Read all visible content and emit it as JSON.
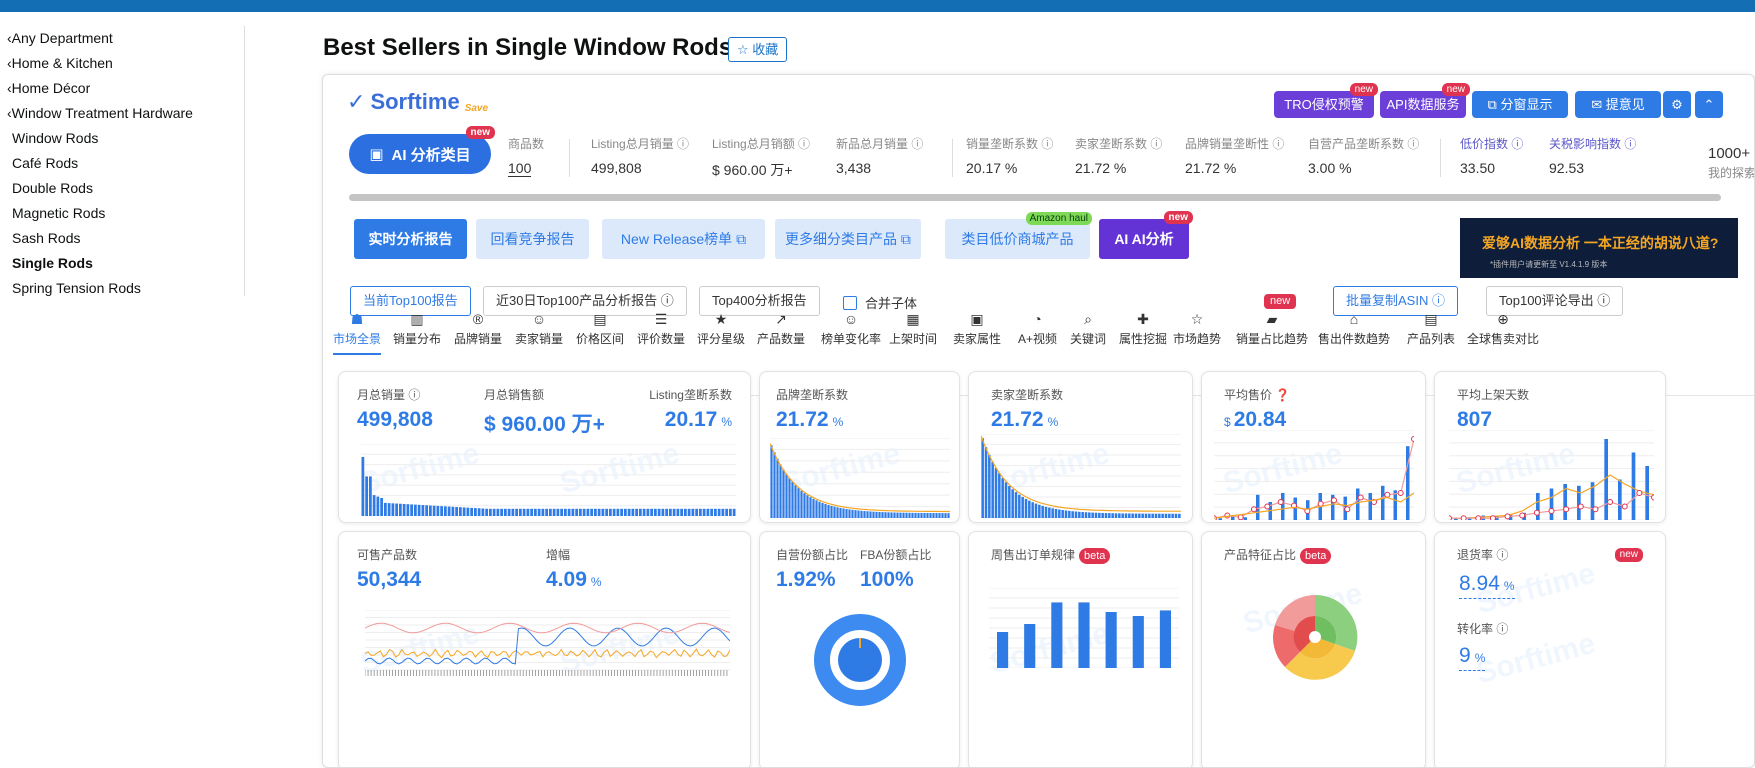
{
  "sidebar": {
    "items": [
      {
        "label": "‹Any Department",
        "sub": false,
        "selected": false
      },
      {
        "label": "‹Home & Kitchen",
        "sub": false,
        "selected": false
      },
      {
        "label": "‹Home Décor",
        "sub": false,
        "selected": false
      },
      {
        "label": "‹Window Treatment Hardware",
        "sub": false,
        "selected": false
      },
      {
        "label": "Window Rods",
        "sub": true,
        "selected": false
      },
      {
        "label": "Café Rods",
        "sub": true,
        "selected": false
      },
      {
        "label": "Double Rods",
        "sub": true,
        "selected": false
      },
      {
        "label": "Magnetic Rods",
        "sub": true,
        "selected": false
      },
      {
        "label": "Sash Rods",
        "sub": true,
        "selected": false
      },
      {
        "label": "Single Rods",
        "sub": true,
        "selected": true
      },
      {
        "label": "Spring Tension Rods",
        "sub": true,
        "selected": false
      }
    ]
  },
  "page": {
    "title": "Best Sellers in Single Window Rods",
    "fav_label": "☆ 收藏"
  },
  "plugin": {
    "logo_text": "Sorftime",
    "logo_save": "Save",
    "top_buttons": [
      {
        "label": "TRO侵权预警",
        "new": "new",
        "color": "#6b3fd8"
      },
      {
        "label": "API数据服务",
        "new": "new",
        "color": "#6b3fd8"
      },
      {
        "label": "⧉ 分窗显示",
        "new": "",
        "color": "#2f7be5"
      },
      {
        "label": "✉ 提意见",
        "new": "",
        "color": "#2f7be5"
      },
      {
        "label": "⚙",
        "new": "",
        "color": "#2f7be5"
      },
      {
        "label": "⌃",
        "new": "",
        "color": "#2f7be5"
      }
    ],
    "ai_button": {
      "label": "AI 分析类目",
      "new": "new"
    },
    "metrics": [
      {
        "label": "商品数",
        "value": "100",
        "ul": true
      },
      {
        "label": "Listing总月销量 ⓘ",
        "value": "499,808",
        "ul": false
      },
      {
        "label": "Listing总月销额 ⓘ",
        "value": "$ 960.00 万+",
        "ul": false
      },
      {
        "label": "新品总月销量 ⓘ",
        "value": "3,438",
        "ul": false
      },
      {
        "label": "销量垄断系数 ⓘ",
        "value": "20.17 %",
        "ul": false
      },
      {
        "label": "卖家垄断系数 ⓘ",
        "value": "21.72 %",
        "ul": false
      },
      {
        "label": "品牌销量垄断性 ⓘ",
        "value": "21.72 %",
        "ul": false
      },
      {
        "label": "自营产品垄断系数 ⓘ",
        "value": "3.00 %",
        "ul": false
      },
      {
        "label": "低价指数 ⓘ",
        "value": "33.50",
        "ul": false
      },
      {
        "label": "关税影响指数 ⓘ",
        "value": "92.53",
        "ul": false
      }
    ],
    "extra_value": "1000+",
    "extra_label": "我的探索指",
    "action_buttons": [
      {
        "label": "实时分析报告",
        "style": "pri",
        "tag": ""
      },
      {
        "label": "回看竞争报告",
        "style": "lt",
        "tag": ""
      },
      {
        "label": "New Release榜单 ⧉",
        "style": "lt",
        "tag": ""
      },
      {
        "label": "更多细分类目产品 ⧉",
        "style": "lt",
        "tag": ""
      },
      {
        "label": "类目低价商城产品",
        "style": "lt",
        "tag": "Amazon haul"
      },
      {
        "label": "AI AI分析",
        "style": "ai",
        "tag": "new"
      }
    ],
    "banner": {
      "text": "爱够AI数据分析 一本正经的胡说八道?",
      "small": "*插件用户请更新至 V1.4.1.9 版本"
    },
    "options": [
      {
        "label": "当前Top100报告",
        "active": true
      },
      {
        "label": "近30日Top100产品分析报告 ⓘ",
        "active": false
      },
      {
        "label": "Top400分析报告",
        "active": false
      }
    ],
    "merge_label": "合并子体",
    "right_options": [
      {
        "label": "批量复制ASIN ⓘ",
        "active": true
      },
      {
        "label": "Top100评论导出 ⓘ",
        "active": false
      }
    ],
    "tabs": [
      {
        "icon": "☗",
        "label": "市场全景",
        "active": true,
        "new": ""
      },
      {
        "icon": "▥",
        "label": "销量分布",
        "active": false,
        "new": ""
      },
      {
        "icon": "®",
        "label": "品牌销量",
        "active": false,
        "new": ""
      },
      {
        "icon": "☺",
        "label": "卖家销量",
        "active": false,
        "new": ""
      },
      {
        "icon": "▤",
        "label": "价格区间",
        "active": false,
        "new": ""
      },
      {
        "icon": "☰",
        "label": "评价数量",
        "active": false,
        "new": ""
      },
      {
        "icon": "★",
        "label": "评分星级",
        "active": false,
        "new": ""
      },
      {
        "icon": "↗",
        "label": "产品数量",
        "active": false,
        "new": ""
      },
      {
        "icon": "☺",
        "label": "榜单变化率",
        "active": false,
        "new": ""
      },
      {
        "icon": "▦",
        "label": "上架时间",
        "active": false,
        "new": ""
      },
      {
        "icon": "▣",
        "label": "卖家属性",
        "active": false,
        "new": ""
      },
      {
        "icon": "◔",
        "label": "A+视频",
        "active": false,
        "new": ""
      },
      {
        "icon": "⌕",
        "label": "关键词",
        "active": false,
        "new": ""
      },
      {
        "icon": "✚",
        "label": "属性挖掘",
        "active": false,
        "new": ""
      },
      {
        "icon": "☆",
        "label": "市场趋势",
        "active": false,
        "new": ""
      },
      {
        "icon": "▰",
        "label": "销量占比趋势",
        "active": false,
        "new": "new"
      },
      {
        "icon": "⌂",
        "label": "售出件数趋势",
        "active": false,
        "new": ""
      },
      {
        "icon": "▤",
        "label": "产品列表",
        "active": false,
        "new": ""
      },
      {
        "icon": "⊕",
        "label": "全球售卖对比",
        "active": false,
        "new": ""
      }
    ],
    "cards": {
      "c1": {
        "l1": "月总销量 ⓘ",
        "v1": "499,808",
        "l2": "月总销售额",
        "v2": "$ 960.00 万+",
        "l3": "Listing垄断系数",
        "v3": "20.17",
        "u3": "%"
      },
      "c2": {
        "l": "品牌垄断系数",
        "v": "21.72",
        "u": "%"
      },
      "c3": {
        "l": "卖家垄断系数",
        "v": "21.72",
        "u": "%"
      },
      "c4": {
        "l": "平均售价 ❓",
        "cur": "$",
        "v": "20.84"
      },
      "c5": {
        "l": "平均上架天数",
        "v": "807"
      },
      "c6": {
        "l1": "可售产品数",
        "v1": "50,344",
        "l2": "增幅",
        "v2": "4.09",
        "u2": "%"
      },
      "c7": {
        "l1": "自营份额占比",
        "v1": "1.92%",
        "l2": "FBA份额占比",
        "v2": "100%"
      },
      "c8": {
        "l": "周售出订单规律",
        "beta": "beta"
      },
      "c9": {
        "l": "产品特征占比",
        "beta": "beta"
      },
      "c10": {
        "l1": "退货率 ⓘ",
        "v1": "8.94",
        "u1": "%",
        "l2": "转化率 ⓘ",
        "v2": "9",
        "u2": "%",
        "new": "new"
      }
    },
    "watermark": "Sorftime"
  },
  "colors": {
    "accent": "#2f7be5",
    "purple": "#6b3fd8",
    "red": "#e0334f",
    "orange": "#f5a623"
  }
}
